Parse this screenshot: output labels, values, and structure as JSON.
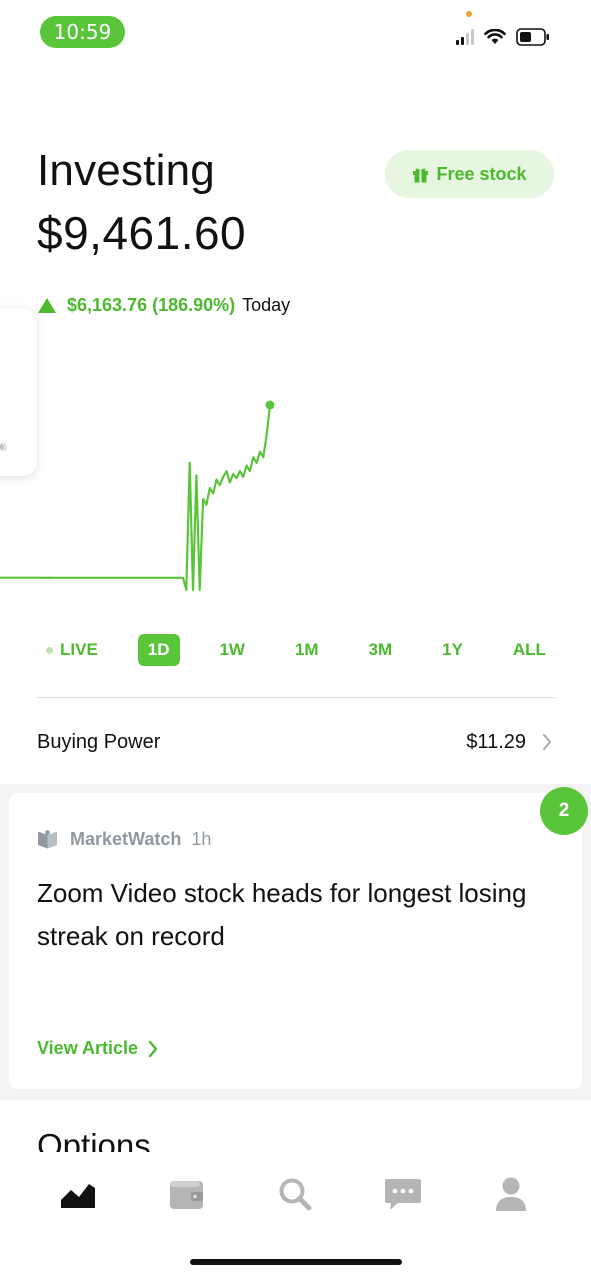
{
  "status_bar": {
    "time": "10:59"
  },
  "header": {
    "title": "Investing",
    "balance": "$9,461.60",
    "free_stock_label": "Free stock",
    "change_amount": "$6,163.76 (186.90%)",
    "change_period": "Today"
  },
  "colors": {
    "accent": "#5ac53b",
    "accent_text": "#4cb92f",
    "pill_bg": "#e6f6e1"
  },
  "chart_data": {
    "type": "line",
    "series": [
      {
        "values": [
          3297.8,
          3297.6,
          3297.9,
          3297.7,
          3297.5,
          3297.6,
          3297.3,
          3297.4,
          3297.1,
          3297.2,
          3296.9,
          3297.1,
          3296.8,
          3297.0,
          3296.7,
          3296.9,
          3296.6,
          3296.8,
          3296.5,
          3296.9,
          3296.7,
          3296.6,
          3296.8,
          3296.7,
          3297.0,
          3297.1,
          3296.9,
          3297.0,
          3296.8,
          3297.1,
          3297.0,
          3296.9,
          3297.1,
          3297.2,
          3296.3,
          2860,
          7400,
          2860,
          6950,
          2860,
          6100,
          5900,
          6500,
          6300,
          6800,
          6600,
          6900,
          7100,
          6700,
          7000,
          6850,
          7100,
          6900,
          7300,
          7100,
          7600,
          7400,
          7800,
          7600,
          8400,
          9461.6
        ]
      }
    ]
  },
  "range_tabs": [
    "LIVE",
    "1D",
    "1W",
    "1M",
    "3M",
    "1Y",
    "ALL"
  ],
  "active_range": "1D",
  "buying_power": {
    "label": "Buying Power",
    "value": "$11.29"
  },
  "news": {
    "badge_count": "2",
    "source": "MarketWatch",
    "age": "1h",
    "headline": "Zoom Video stock heads for longest losing streak on record",
    "cta": "View Article"
  },
  "next_section_title": "Options",
  "bottom_nav": [
    {
      "icon": "chart-icon"
    },
    {
      "icon": "wallet-icon"
    },
    {
      "icon": "search-icon"
    },
    {
      "icon": "messages-icon"
    },
    {
      "icon": "account-icon"
    }
  ]
}
